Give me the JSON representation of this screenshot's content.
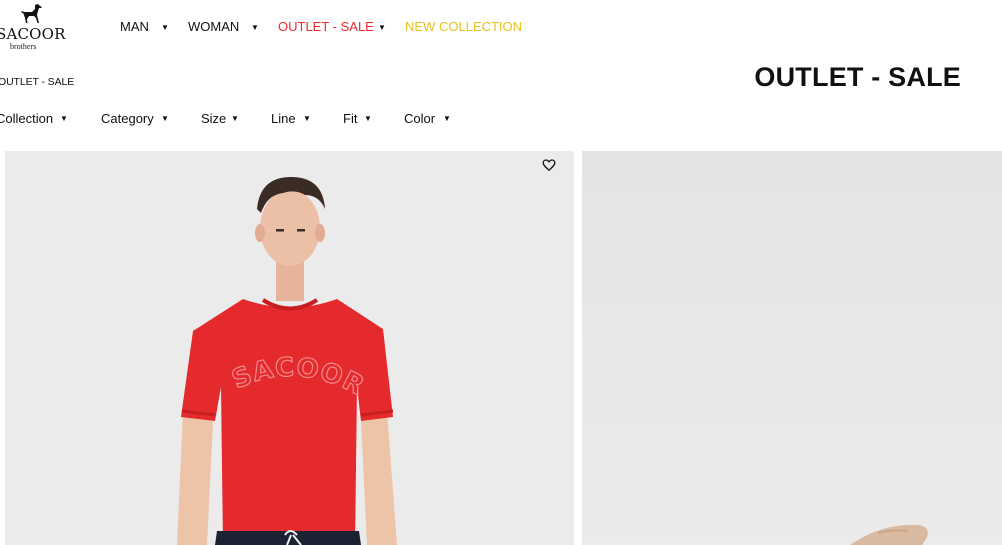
{
  "brand": {
    "name": "SACOOR",
    "sub": "brothers",
    "icon": "greyhound-dog-icon"
  },
  "main_nav": [
    {
      "label": "MAN",
      "color": "#111111"
    },
    {
      "label": "WOMAN",
      "color": "#111111"
    },
    {
      "label": "OUTLET - SALE",
      "color": "#e52b2b"
    },
    {
      "label": "NEW COLLECTION",
      "color": "#e7c21e"
    }
  ],
  "breadcrumb": "OUTLET - SALE",
  "page_title": "OUTLET - SALE",
  "filters": [
    "Collection",
    "Category",
    "Size",
    "Line",
    "Fit",
    "Color"
  ],
  "products": [
    {
      "image_alt": "Man wearing red SACOOR logo t-shirt",
      "print_text": "SACOOR",
      "wishlist_icon": "heart-outline-icon"
    },
    {
      "image_alt": "Product photo on light grey background"
    }
  ],
  "colors": {
    "sale": "#e52b2b",
    "new_collection": "#e7c21e",
    "shirt_red": "#e52a2d"
  }
}
